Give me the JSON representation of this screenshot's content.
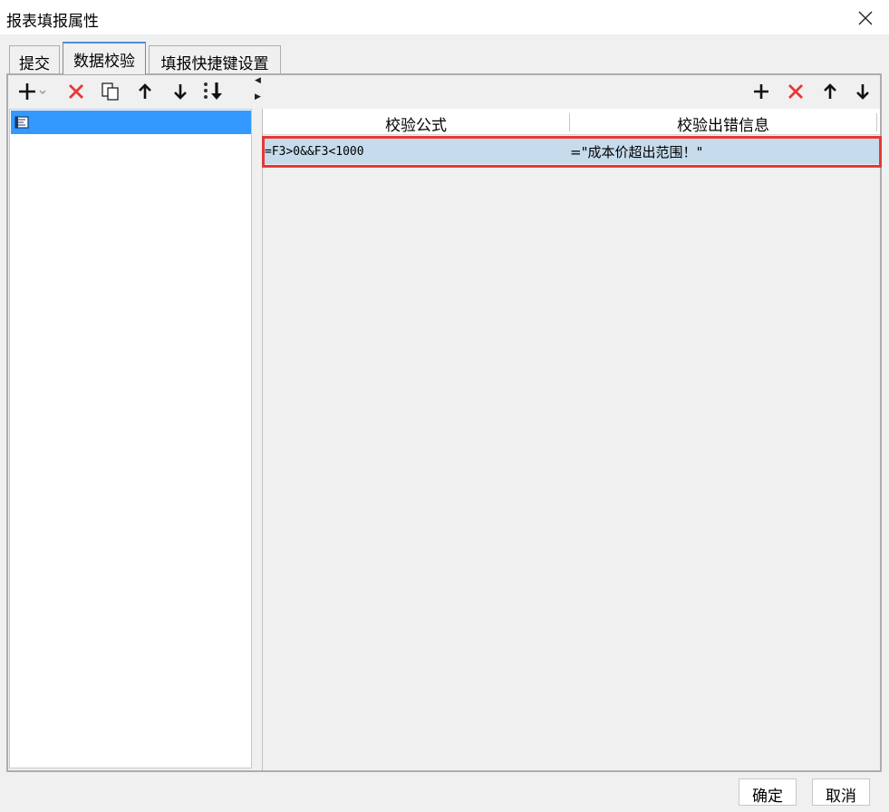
{
  "window": {
    "title": "报表填报属性",
    "close_icon": "close-icon"
  },
  "tabs": [
    {
      "label": "提交",
      "active": false
    },
    {
      "label": "数据校验",
      "active": true
    },
    {
      "label": "填报快捷键设置",
      "active": false
    }
  ],
  "left_toolbar": {
    "icons": [
      "add-dropdown-icon",
      "delete-icon",
      "copy-icon",
      "move-up-icon",
      "move-down-icon",
      "move-bottom-icon"
    ],
    "delete_color": "#e53935"
  },
  "left_list": {
    "items": [
      {
        "icon": "document-icon",
        "selected": true
      }
    ]
  },
  "right_toolbar": {
    "icons": [
      "add-icon",
      "delete-icon",
      "move-up-icon",
      "move-down-icon"
    ]
  },
  "grid": {
    "columns": [
      "校验公式",
      "校验出错信息"
    ],
    "rows": [
      {
        "formula": "=F3>0&&F3<1000",
        "message": "=\"成本价超出范围！\""
      }
    ],
    "highlight_color": "#e53935",
    "selected_row_color": "#c6dcec"
  },
  "footer": {
    "ok_label": "确定",
    "cancel_label": "取消"
  }
}
